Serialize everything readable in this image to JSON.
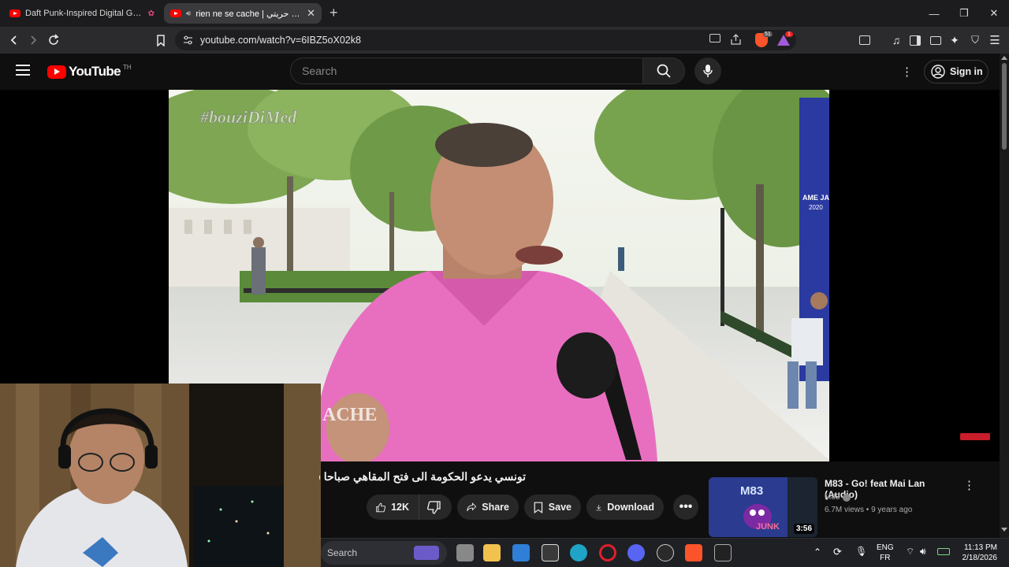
{
  "browser": {
    "tabs": [
      {
        "title": "Daft Punk-Inspired Digital Galaxy",
        "active": false
      },
      {
        "title": "rien ne se cache | وهذه حريتي",
        "active": true
      }
    ],
    "url": "youtube.com/watch?v=6IBZ5oX02k8",
    "shield_badge": "51",
    "alert_badge": "1"
  },
  "youtube": {
    "logo_text": "YouTube",
    "logo_region": "TH",
    "search_placeholder": "Search",
    "sign_in_label": "Sign in"
  },
  "video": {
    "watermark": "#bouziDiMed",
    "overlay_text": "ACHE",
    "poster_text": "AME JA",
    "poster_year": "2020",
    "title": "تونسي يدعو الحكومة الى فتح المقاهي صباحا في",
    "likes": "12K",
    "share_label": "Share",
    "save_label": "Save",
    "download_label": "Download"
  },
  "recommendation": {
    "title": "M83 - Go! feat Mai Lan (Audio)",
    "channel": "M83",
    "views": "6.7M views",
    "age": "9 years ago",
    "duration": "3:56",
    "thumb_text_top": "M83",
    "thumb_text_bottom": "JUNK"
  },
  "taskbar": {
    "search_label": "Search",
    "lang_primary": "ENG",
    "lang_secondary": "FR",
    "time": "11:13 PM",
    "date": "2/18/2026"
  },
  "colors": {
    "youtube_red": "#ff0000",
    "background": "#0f0f0f",
    "pink_shirt": "#e86fc0"
  }
}
